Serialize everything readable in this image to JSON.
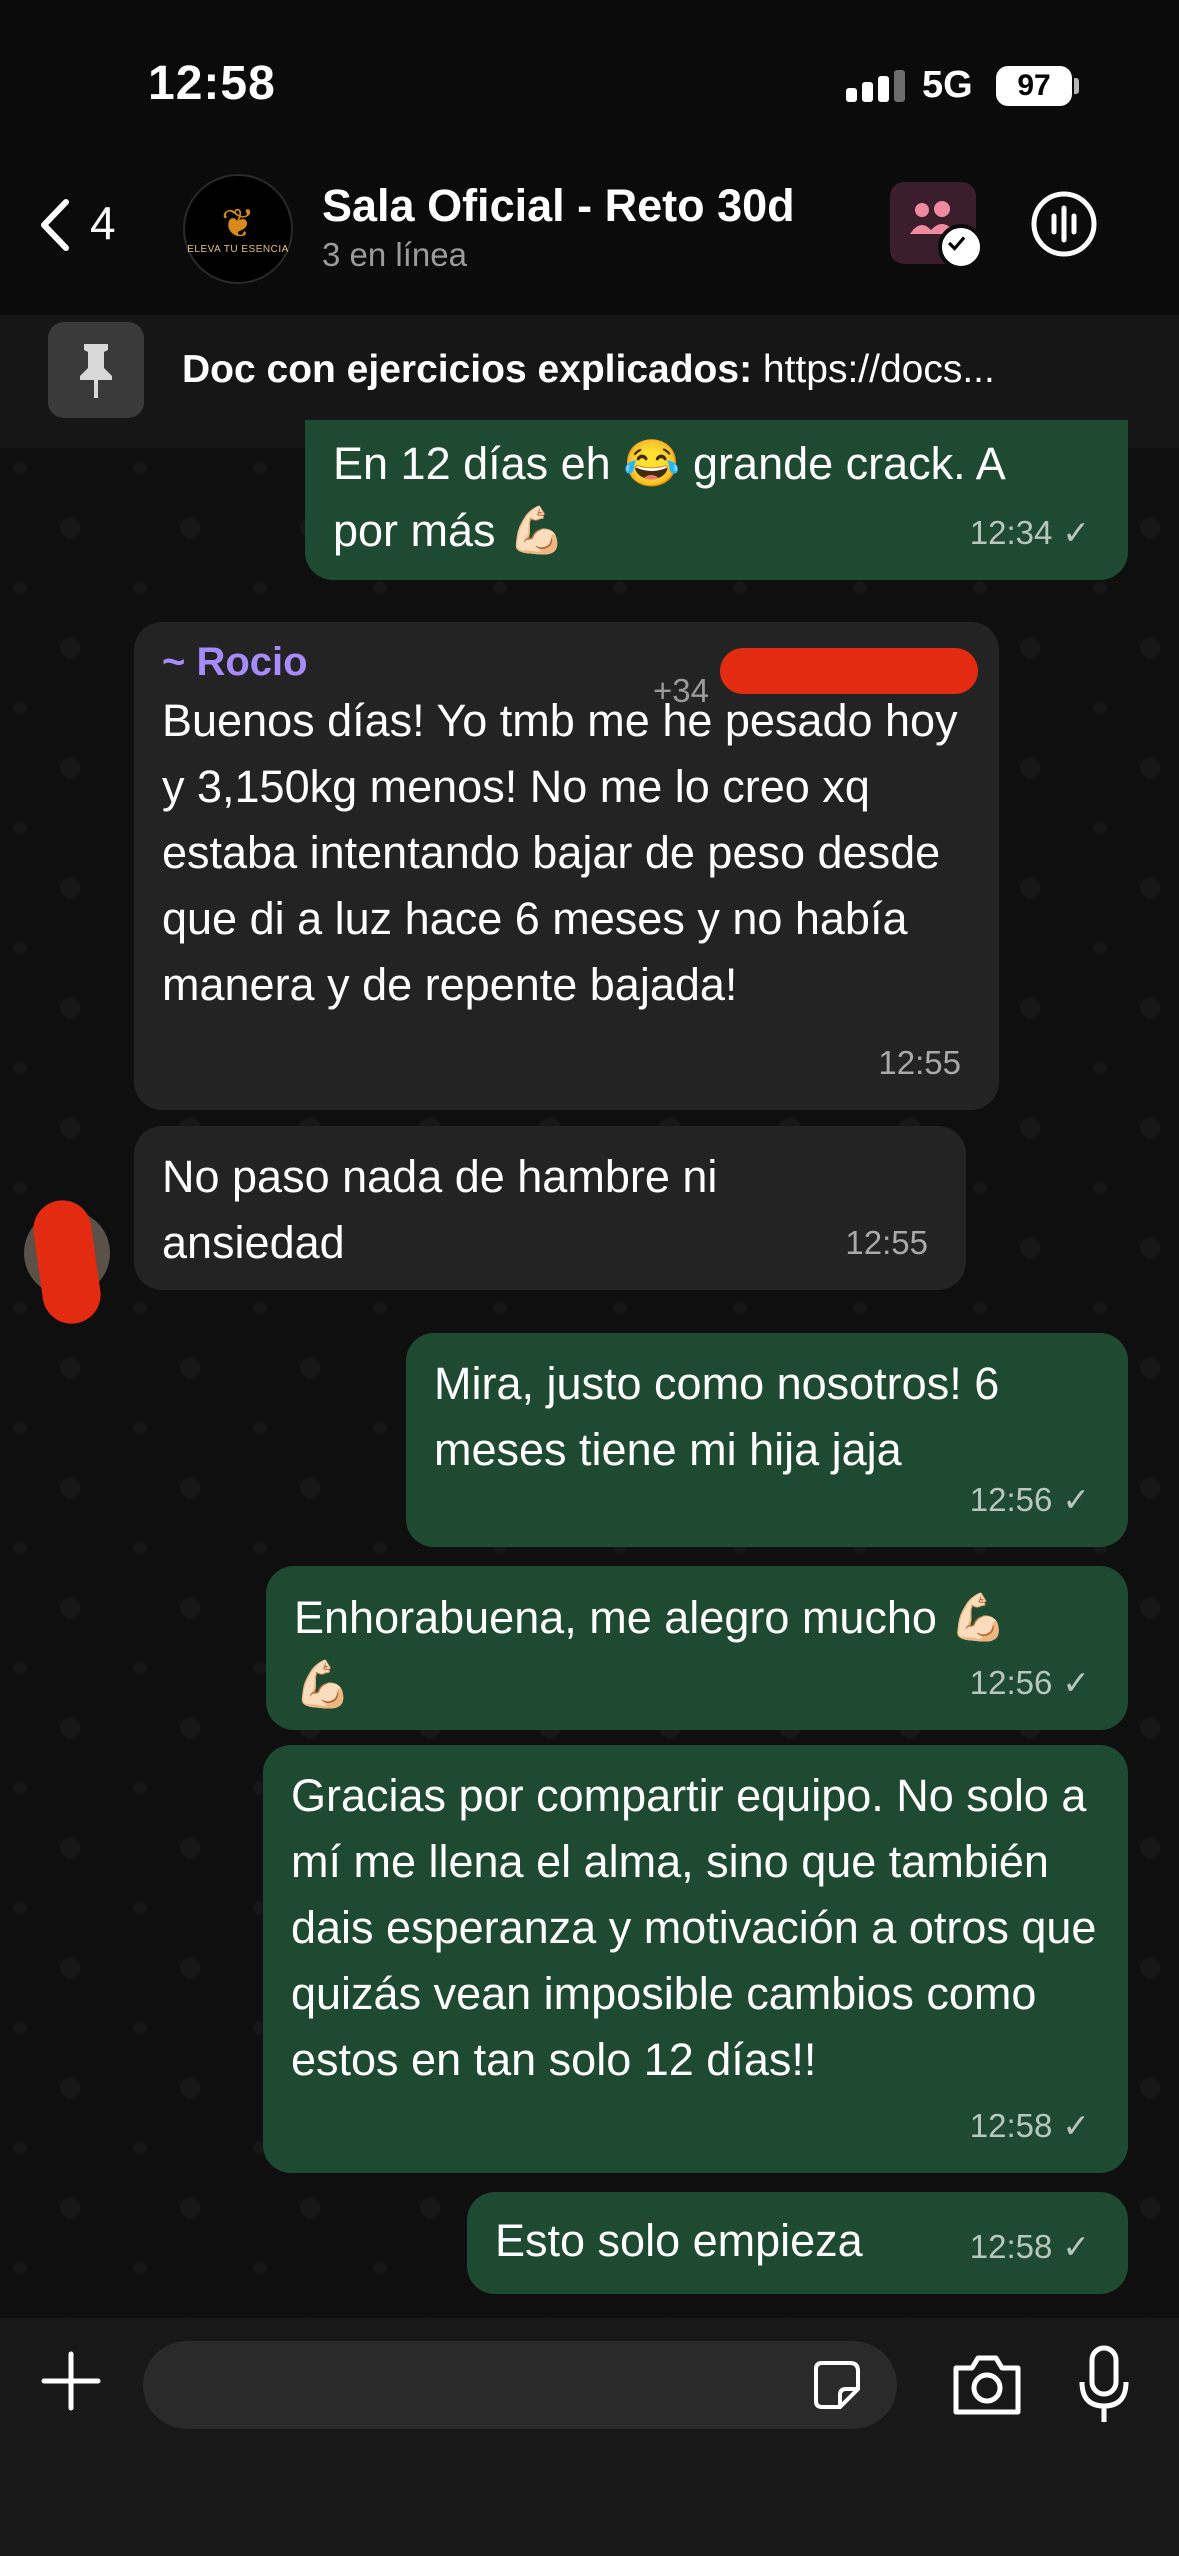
{
  "status_bar": {
    "time": "12:58",
    "network": "5G",
    "battery": "97"
  },
  "header": {
    "back_count": "4",
    "title": "Sala Oficial - Reto 30d",
    "subtitle": "3 en línea",
    "avatar_text": "ELEVA TU ESENCIA"
  },
  "pinned": {
    "label": "Doc con ejercicios explicados:",
    "value": "https://docs..."
  },
  "messages": [
    {
      "direction": "out",
      "text_line1": "En 12 días eh",
      "emoji1": "😂",
      "text_line1b": "grande crack. A",
      "text_line2": "por más",
      "emoji2": "💪🏻",
      "time": "12:34",
      "status": "✓"
    },
    {
      "direction": "in",
      "sender": "~ Rocio",
      "phone": "+34",
      "text": "Buenos días! Yo tmb me he pesado hoy y 3,150kg menos! No me lo creo xq estaba intentando bajar de peso desde que di a luz hace 6 meses y no había manera y de repente bajada!",
      "time": "12:55"
    },
    {
      "direction": "in",
      "text": "No paso nada de hambre ni ansiedad",
      "time": "12:55"
    },
    {
      "direction": "out",
      "text": "Mira, justo como nosotros! 6 meses tiene mi hija jaja",
      "time": "12:56",
      "status": "✓"
    },
    {
      "direction": "out",
      "text": "Enhorabuena, me alegro mucho",
      "emoji": "💪🏻",
      "emoji_b": "💪🏻",
      "time": "12:56",
      "status": "✓"
    },
    {
      "direction": "out",
      "text": "Gracias por compartir equipo. No solo a mí me llena el alma, sino que también dais esperanza y motivación a otros que quizás vean imposible cambios como estos en tan solo 12 días!!",
      "time": "12:58",
      "status": "✓"
    },
    {
      "direction": "out",
      "text": "Esto solo empieza",
      "time": "12:58",
      "status": "✓"
    }
  ],
  "composer": {
    "placeholder": ""
  },
  "colors": {
    "outgoing": "#1f4a32",
    "incoming": "#232323",
    "sender_name": "#a78bfa",
    "redaction": "#e32b12"
  }
}
